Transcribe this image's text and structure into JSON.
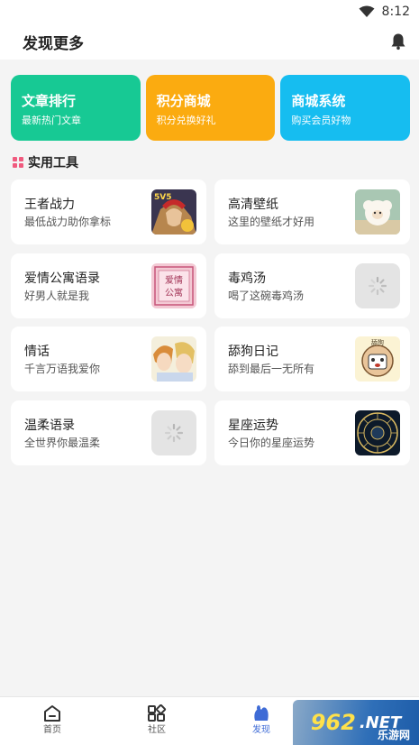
{
  "status_bar": {
    "time": "8:12",
    "wifi_icon": "wifi-icon"
  },
  "header": {
    "title": "发现更多",
    "bell_icon": "bell-icon"
  },
  "features": [
    {
      "title": "文章排行",
      "subtitle": "最新热门文章",
      "color": "#17c994"
    },
    {
      "title": "积分商城",
      "subtitle": "积分兑换好礼",
      "color": "#fbab10"
    },
    {
      "title": "商城系统",
      "subtitle": "购买会员好物",
      "color": "#16bdf0"
    }
  ],
  "section_title": "实用工具",
  "tools": [
    {
      "title": "王者战力",
      "subtitle": "最低战力助你拿标",
      "thumb": "game-hero-image"
    },
    {
      "title": "高清壁纸",
      "subtitle": "这里的壁纸才好用",
      "thumb": "sheep-image"
    },
    {
      "title": "爱情公寓语录",
      "subtitle": "好男人就是我",
      "thumb": "love-apartment-image"
    },
    {
      "title": "毒鸡汤",
      "subtitle": "喝了这碗毒鸡汤",
      "thumb": "loading"
    },
    {
      "title": "情话",
      "subtitle": "千言万语我爱你",
      "thumb": "anime-couple-image"
    },
    {
      "title": "舔狗日记",
      "subtitle": "舔到最后一无所有",
      "thumb": "dog-mascot-image"
    },
    {
      "title": "温柔语录",
      "subtitle": "全世界你最温柔",
      "thumb": "loading"
    },
    {
      "title": "星座运势",
      "subtitle": "今日你的星座运势",
      "thumb": "zodiac-image"
    }
  ],
  "thumb_text": {
    "love_apartment": [
      "爱情",
      "公寓"
    ],
    "dog": "舔狗",
    "game_badge": "5V5"
  },
  "nav": [
    {
      "label": "首页",
      "icon": "home-icon",
      "active": false
    },
    {
      "label": "社区",
      "icon": "community-icon",
      "active": false
    },
    {
      "label": "发现",
      "icon": "discover-icon",
      "active": true
    }
  ],
  "watermark": {
    "brand": "962",
    "suffix": ".NET",
    "sub": "乐游网"
  },
  "colors": {
    "accent": "#3e6bd6",
    "section_icon": "#f05a7e"
  }
}
